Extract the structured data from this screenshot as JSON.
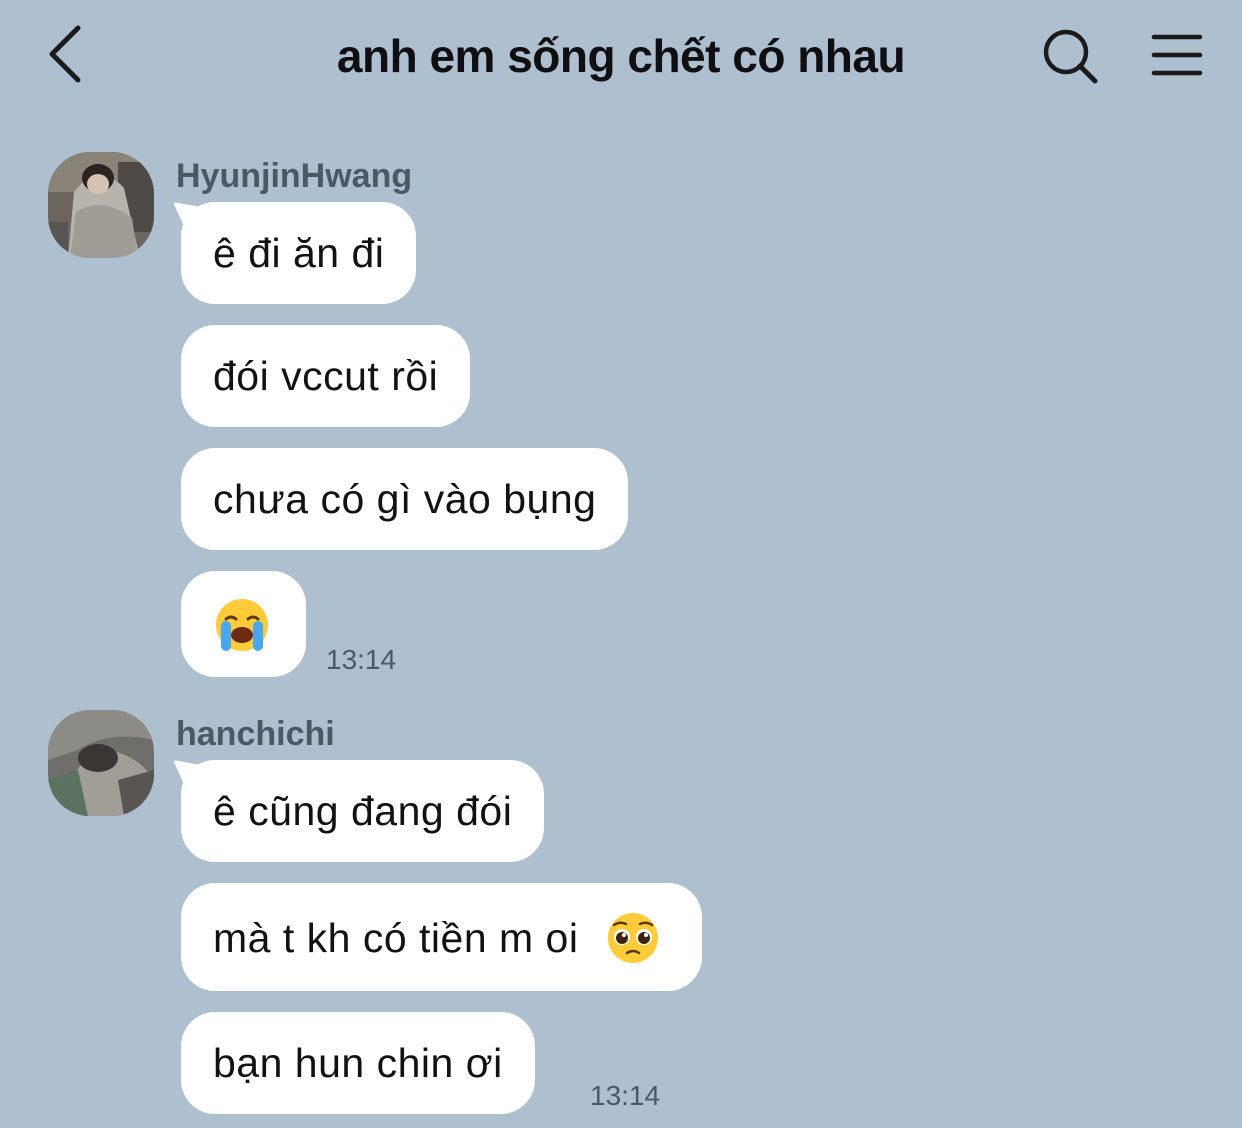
{
  "header": {
    "title": "anh em sống chết có nhau",
    "back_icon": "chevron-left-icon",
    "search_icon": "search-icon",
    "menu_icon": "hamburger-menu-icon"
  },
  "groups": [
    {
      "sender": "HyunjinHwang",
      "messages": [
        {
          "text": "ê đi ăn đi"
        },
        {
          "text": "đói vccut rồi"
        },
        {
          "text": "chưa có gì vào bụng"
        },
        {
          "text": "",
          "emoji": "loudly-crying-face-emoji"
        }
      ],
      "time": "13:14"
    },
    {
      "sender": "hanchichi",
      "messages": [
        {
          "text": "ê cũng đang đói"
        },
        {
          "text": "mà t kh có tiền m oi",
          "emoji": "pleading-face-emoji"
        },
        {
          "text": "bạn hun chin ơi"
        }
      ],
      "time": "13:14"
    }
  ],
  "colors": {
    "background": "#aebfcf",
    "bubble": "#ffffff",
    "name_text": "#4b5866"
  }
}
